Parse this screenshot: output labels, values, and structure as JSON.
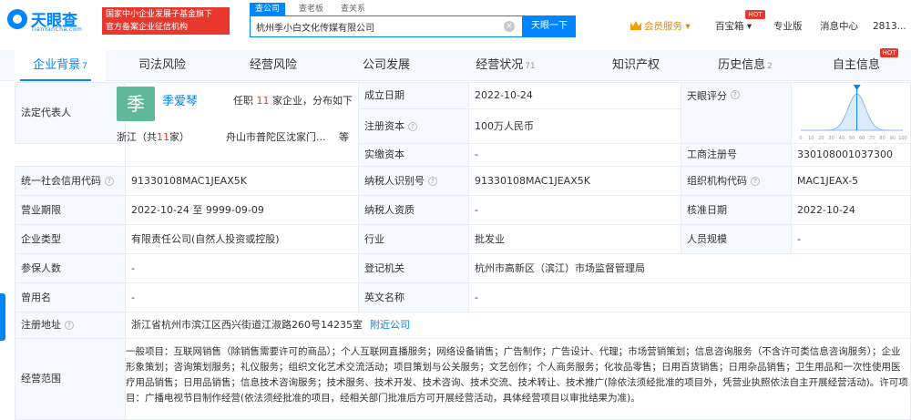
{
  "brand": {
    "name": "天眼查",
    "sub": "TianYanCha.com",
    "slogan_line1": "国家中小企业发展子基金旗下",
    "slogan_line2": "官方备案企业征信机构"
  },
  "search": {
    "tabs": [
      "查公司",
      "查老板",
      "查关系"
    ],
    "value": "杭州季小白文化传媒有限公司",
    "clear_icon": "close-icon",
    "button": "天眼一下"
  },
  "top_nav": {
    "vip": "会员服务",
    "vip_arrow": "▾",
    "treasure": "百宝箱",
    "treasure_arrow": "▾",
    "pro": "专业版",
    "messages": "消息中心",
    "user": "2813...",
    "hot": "HOT"
  },
  "tabs": [
    {
      "label": "企业背景",
      "count": "7"
    },
    {
      "label": "司法风险",
      "count": ""
    },
    {
      "label": "经营风险",
      "count": ""
    },
    {
      "label": "公司发展",
      "count": ""
    },
    {
      "label": "经营状况",
      "count": "71"
    },
    {
      "label": "知识产权",
      "count": ""
    },
    {
      "label": "历史信息",
      "count": "2"
    },
    {
      "label": "自主信息",
      "count": ""
    }
  ],
  "tab_hot": "HOT",
  "rep": {
    "label": "法定代表人",
    "avatar_char": "季",
    "name": "季爱琴",
    "info_prefix": "任职",
    "info_count": "11",
    "info_suffix": "家企业，分布如下",
    "province": "浙江（共",
    "province_count": "11",
    "province_suffix": "家）",
    "location": "舟山市普陀区沈家门...",
    "etc": "等"
  },
  "fields": {
    "founded_label": "成立日期",
    "founded": "2022-10-24",
    "score_label": "天眼评分",
    "capital_label": "注册资本",
    "capital": "100万人民币",
    "paid_label": "实缴资本",
    "paid": "-",
    "reg_no_label": "工商注册号",
    "reg_no": "330108001037300",
    "credit_label": "统一社会信用代码",
    "credit": "91330108MAC1JEAX5K",
    "tax_label": "纳税人识别号",
    "tax": "91330108MAC1JEAX5K",
    "org_label": "组织机构代码",
    "org": "MAC1JEAX-5",
    "term_label": "营业期限",
    "term": "2022-10-24 至 9999-09-09",
    "taxq_label": "纳税人资质",
    "taxq": "-",
    "approve_label": "核准日期",
    "approve": "2022-10-24",
    "type_label": "企业类型",
    "type": "有限责任公司(自然人投资或控股)",
    "industry_label": "行业",
    "industry": "批发业",
    "staff_label": "人员规模",
    "staff": "-",
    "insured_label": "参保人数",
    "insured": "-",
    "authority_label": "登记机关",
    "authority": "杭州市高新区（滨江）市场监督管理局",
    "former_label": "曾用名",
    "former": "-",
    "en_label": "英文名称",
    "en": "-",
    "address_label": "注册地址",
    "address": "浙江省杭州市滨江区西兴街道江淑路260号14235室",
    "address_link": "附近公司",
    "scope_label": "经营范围",
    "scope": "一般项目：互联网销售（除销售需要许可的商品）；个人互联网直播服务；网络设备销售；广告制作；广告设计、代理；市场营销策划；信息咨询服务（不含许可类信息咨询服务）；企业形象策划；咨询策划服务；礼仪服务；组织文化艺术交流活动；项目策划与公关服务；文艺创作；个人商务服务；化妆品零售；日用百货销售；日用杂品销售；卫生用品和一次性使用医疗用品销售；日用品销售；信息技术咨询服务；技术服务、技术开发、技术咨询、技术交流、技术转让、技术推广(除依法须经批准的项目外，凭营业执照依法自主开展经营活动)。许可项目：广播电视节目制作经营(依法须经批准的项目，经相关部门批准后方可开展经营活动，具体经营项目以审批结果为准)。"
  },
  "score_chart": {
    "type": "area",
    "xticks": [
      "0",
      "10",
      "20",
      "30",
      "40",
      "50",
      "60",
      "70",
      "80",
      "90",
      "100"
    ],
    "marker": 55
  },
  "colors": {
    "accent": "#0084ff",
    "danger": "#e8372c",
    "label_bg": "#f5f8fc"
  }
}
